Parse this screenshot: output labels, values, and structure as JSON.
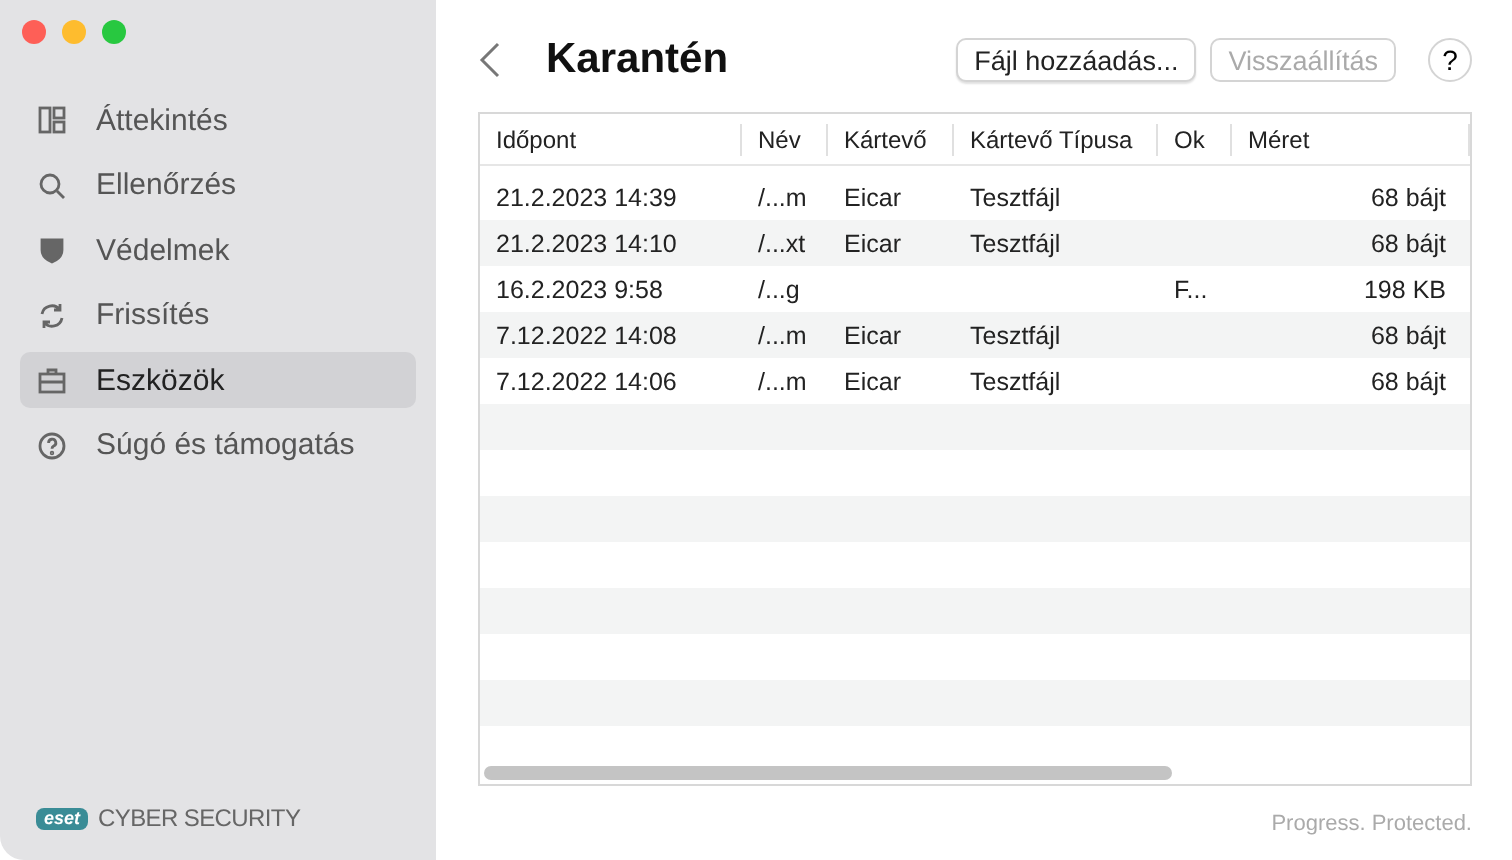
{
  "window": {
    "title": "Karantén"
  },
  "sidebar": {
    "items": [
      {
        "label": "Áttekintés",
        "selected": false
      },
      {
        "label": "Ellenőrzés",
        "selected": false
      },
      {
        "label": "Védelmek",
        "selected": false
      },
      {
        "label": "Frissítés",
        "selected": false
      },
      {
        "label": "Eszközök",
        "selected": true
      },
      {
        "label": "Súgó és támogatás",
        "selected": false
      }
    ],
    "brand": {
      "logo": "eset",
      "product": "CYBER SECURITY"
    }
  },
  "toolbar": {
    "buttons": [
      {
        "label": "Fájl hozzáadás...",
        "disabled": false
      },
      {
        "label": "Visszaállítás",
        "disabled": true
      }
    ],
    "help": "?"
  },
  "table": {
    "columns": [
      "Időpont",
      "Név",
      "Kártevő",
      "Kártevő Típusa",
      "Ok",
      "Méret"
    ],
    "rows": [
      [
        "21.2.2023 14:39",
        "/...m",
        "Eicar",
        "Tesztfájl",
        "",
        "68 bájt"
      ],
      [
        "21.2.2023 14:10",
        "/...xt",
        "Eicar",
        "Tesztfájl",
        "",
        "68 bájt"
      ],
      [
        "16.2.2023 9:58",
        "/...g",
        "",
        "",
        "F...",
        "198 KB"
      ],
      [
        "7.12.2022 14:08",
        "/...m",
        "Eicar",
        "Tesztfájl",
        "",
        "68 bájt"
      ],
      [
        "7.12.2022 14:06",
        "/...m",
        "Eicar",
        "Tesztfájl",
        "",
        "68 bájt"
      ]
    ]
  },
  "footer": {
    "tagline": "Progress. Protected."
  }
}
